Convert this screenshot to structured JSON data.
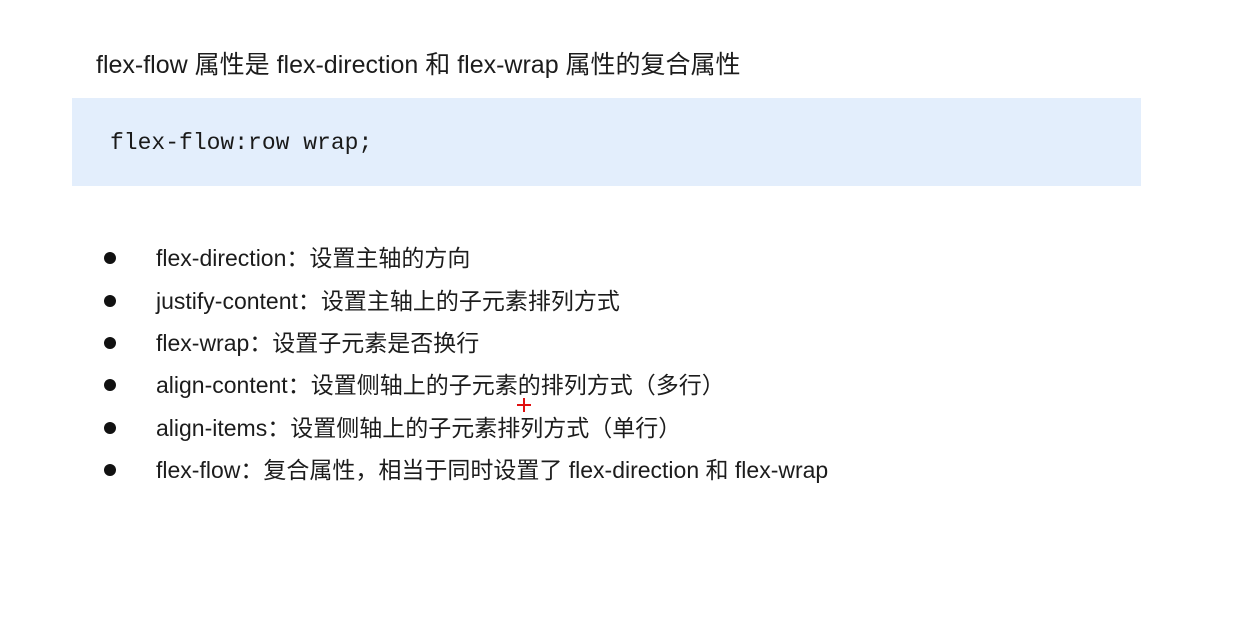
{
  "slide": {
    "heading": "flex-flow 属性是 flex-direction 和 flex-wrap 属性的复合属性",
    "code": "flex-flow:row wrap;",
    "bullets": [
      "flex-direction：设置主轴的方向",
      "justify-content：设置主轴上的子元素排列方式",
      "flex-wrap：设置子元素是否换行",
      "align-content：设置侧轴上的子元素的排列方式（多行）",
      "align-items：设置侧轴上的子元素排列方式（单行）",
      "flex-flow：复合属性，相当于同时设置了 flex-direction 和 flex-wrap"
    ]
  },
  "colors": {
    "code_background": "#e3eefc",
    "cursor": "#e01010"
  }
}
